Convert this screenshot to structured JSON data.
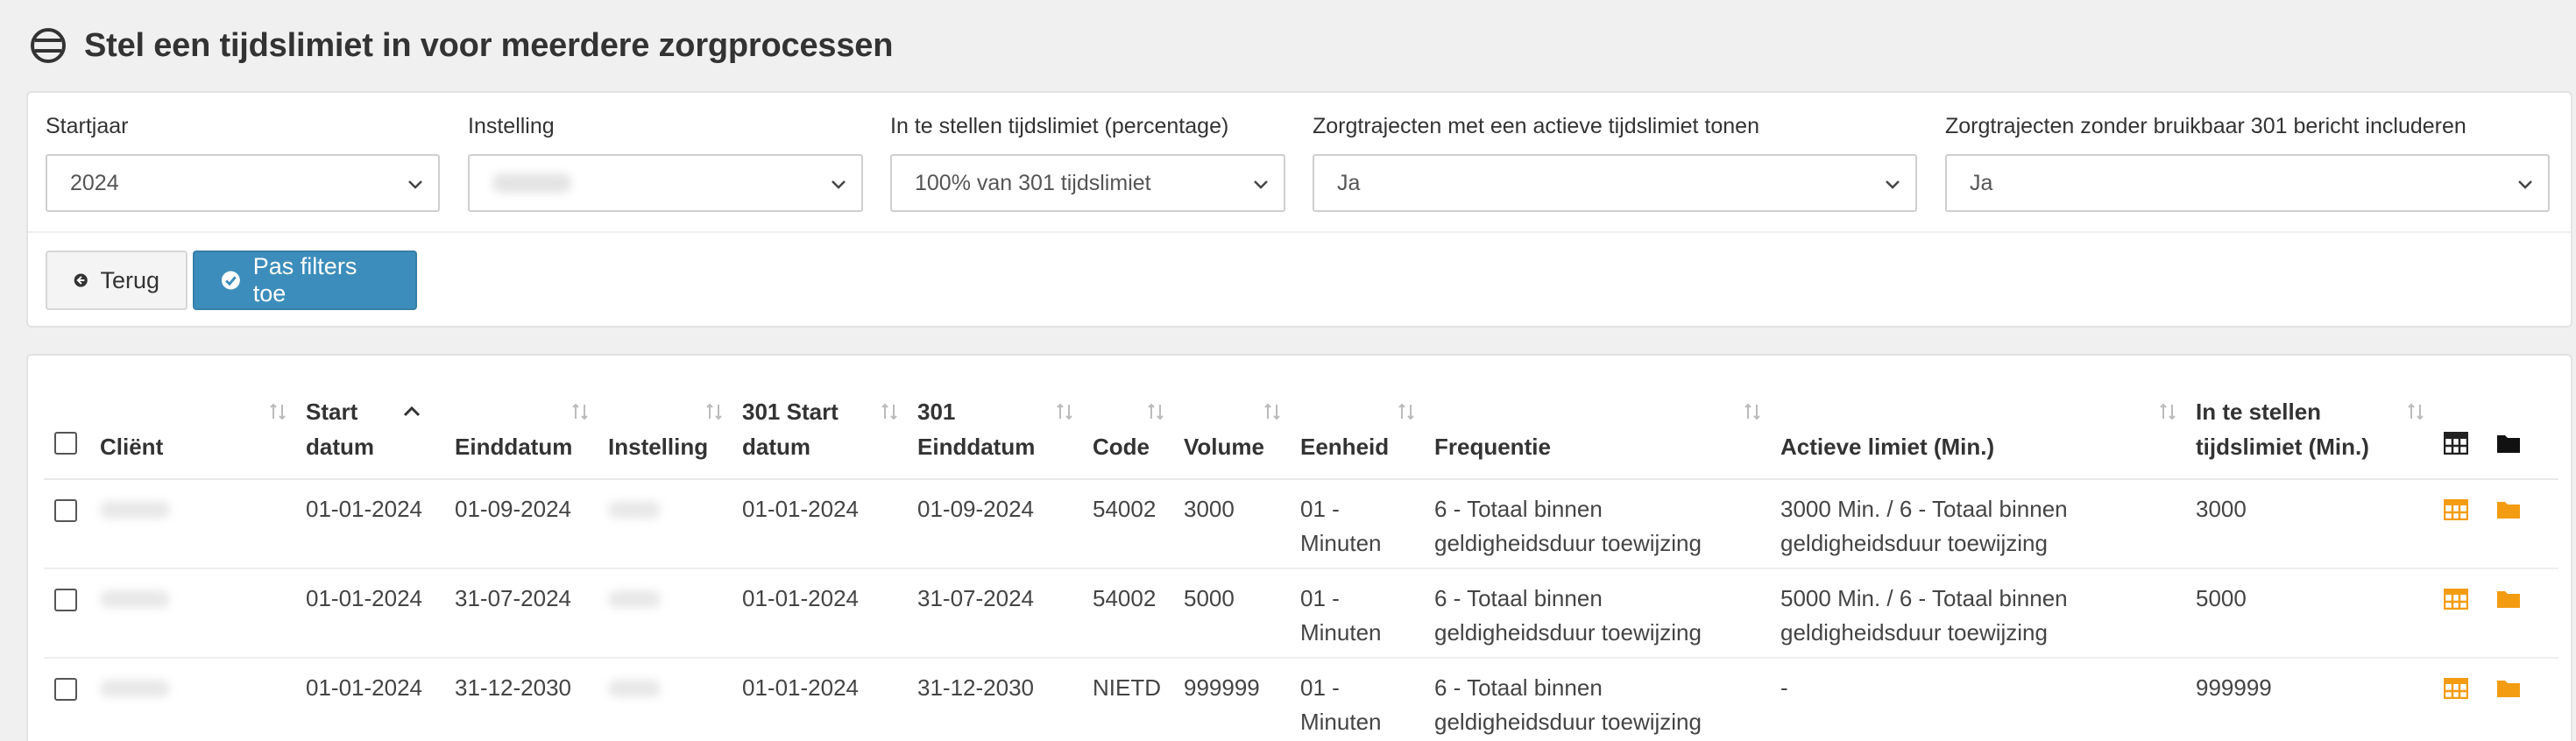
{
  "page": {
    "title": "Stel een tijdslimiet in voor meerdere zorgprocessen",
    "title_icon": "ban-icon"
  },
  "filters": [
    {
      "label": "Startjaar",
      "value": "2024"
    },
    {
      "label": "Instelling",
      "value": ""
    },
    {
      "label": "In te stellen tijdslimiet (percentage)",
      "value": "100% van 301 tijdslimiet"
    },
    {
      "label": "Zorgtrajecten met een actieve tijdslimiet tonen",
      "value": "Ja"
    },
    {
      "label": "Zorgtrajecten zonder bruikbaar 301 bericht includeren",
      "value": "Ja"
    }
  ],
  "buttons": {
    "back_label": "Terug",
    "back_icon": "arrow-circle-left-icon",
    "apply_label": "Pas filters toe",
    "apply_icon": "check-circle-icon"
  },
  "colors": {
    "primary": "#3c8dbc",
    "accent_icon": "#f39c12"
  },
  "table": {
    "columns": [
      {
        "key": "client",
        "l1": "",
        "l2": "Cliënt"
      },
      {
        "key": "start",
        "l1": "Start",
        "l2": "datum"
      },
      {
        "key": "end",
        "l1": "",
        "l2": "Einddatum"
      },
      {
        "key": "inst",
        "l1": "",
        "l2": "Instelling"
      },
      {
        "key": "s301",
        "l1": "301 Start",
        "l2": "datum"
      },
      {
        "key": "e301",
        "l1": "301",
        "l2": "Einddatum"
      },
      {
        "key": "code",
        "l1": "",
        "l2": "Code"
      },
      {
        "key": "volume",
        "l1": "",
        "l2": "Volume"
      },
      {
        "key": "unit",
        "l1": "",
        "l2": "Eenheid"
      },
      {
        "key": "freq",
        "l1": "",
        "l2": "Frequentie"
      },
      {
        "key": "active",
        "l1": "",
        "l2": "Actieve limiet (Min.)"
      },
      {
        "key": "set",
        "l1": "In te stellen",
        "l2": "tijdslimiet (Min.)"
      }
    ],
    "header_icons": [
      "table-icon",
      "folder-icon"
    ],
    "rows": [
      {
        "client": "",
        "start": "01-01-2024",
        "end": "01-09-2024",
        "inst": "",
        "s301": "01-01-2024",
        "e301": "01-09-2024",
        "code": "54002",
        "volume": "3000",
        "unit": "01 - Minuten",
        "freq": "6 - Totaal binnen geldigheidsduur toewijzing",
        "active": "3000 Min. / 6 - Totaal binnen geldigheidsduur toewijzing",
        "set": "3000"
      },
      {
        "client": "",
        "start": "01-01-2024",
        "end": "31-07-2024",
        "inst": "",
        "s301": "01-01-2024",
        "e301": "31-07-2024",
        "code": "54002",
        "volume": "5000",
        "unit": "01 - Minuten",
        "freq": "6 - Totaal binnen geldigheidsduur toewijzing",
        "active": "5000 Min. / 6 - Totaal binnen geldigheidsduur toewijzing",
        "set": "5000"
      },
      {
        "client": "",
        "start": "01-01-2024",
        "end": "31-12-2030",
        "inst": "",
        "s301": "01-01-2024",
        "e301": "31-12-2030",
        "code": "NIETD",
        "volume": "999999",
        "unit": "01 - Minuten",
        "freq": "6 - Totaal binnen geldigheidsduur toewijzing",
        "active": "-",
        "set": "999999"
      }
    ]
  }
}
